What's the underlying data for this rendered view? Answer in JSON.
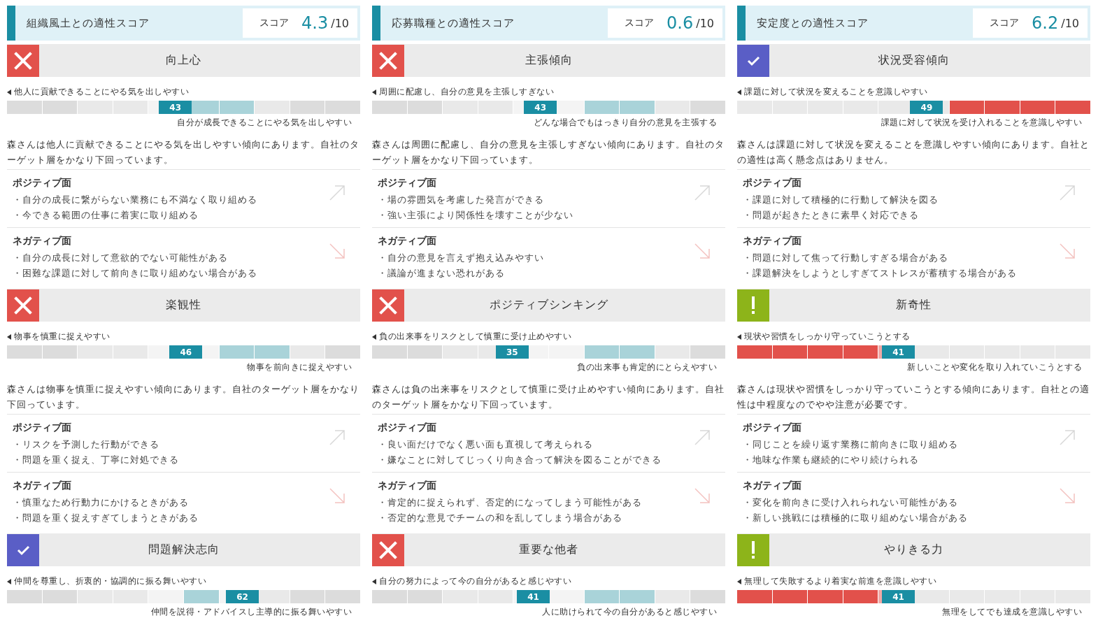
{
  "columns": [
    {
      "title": "組織風土との適性スコア",
      "score_label": "スコア",
      "score": "4.3",
      "score_total": "/10",
      "traits": [
        {
          "name": "向上心",
          "kind": "bad",
          "bar": {
            "left_label": "他人に貢献できることにやる気を出しやすい",
            "right_label": "自分が成長できることにやる気を出しやすい",
            "value": "43",
            "level": 0.43,
            "segments": [
              {
                "kind": "dark"
              },
              {
                "kind": "dark"
              },
              {
                "kind": "light"
              },
              {
                "kind": "light"
              },
              {
                "kind": "pale"
              },
              {
                "kind": "target"
              },
              {
                "kind": "target"
              },
              {
                "kind": "light"
              },
              {
                "kind": "dark"
              },
              {
                "kind": "dark"
              }
            ]
          },
          "description": "森さんは他人に貢献できることにやる気を出しやすい傾向にあります。自社のターゲット層をかなり下回っています。",
          "positive": {
            "heading": "ポジティブ面",
            "items": [
              "・自分の成長に繋がらない業務にも不満なく取り組める",
              "・今できる範囲の仕事に着実に取り組める"
            ]
          },
          "negative": {
            "heading": "ネガティブ面",
            "items": [
              "・自分の成長に対して意欲的でない可能性がある",
              "・困難な課題に対して前向きに取り組めない場合がある"
            ]
          }
        },
        {
          "name": "楽観性",
          "kind": "bad",
          "bar": {
            "left_label": "物事を慎重に捉えやすい",
            "right_label": "物事を前向きに捉えやすい",
            "value": "46",
            "level": 0.46,
            "segments": [
              {
                "kind": "dark"
              },
              {
                "kind": "dark"
              },
              {
                "kind": "light"
              },
              {
                "kind": "light"
              },
              {
                "kind": "pale"
              },
              {
                "kind": "pale"
              },
              {
                "kind": "target"
              },
              {
                "kind": "target"
              },
              {
                "kind": "light"
              },
              {
                "kind": "dark"
              }
            ]
          },
          "description": "森さんは物事を慎重に捉えやすい傾向にあります。自社のターゲット層をかなり下回っています。",
          "positive": {
            "heading": "ポジティブ面",
            "items": [
              "・リスクを予測した行動ができる",
              "・問題を重く捉え、丁寧に対処できる"
            ]
          },
          "negative": {
            "heading": "ネガティブ面",
            "items": [
              "・慎重なため行動力にかけるときがある",
              "・問題を重く捉えすぎてしまうときがある"
            ]
          }
        },
        {
          "name": "問題解決志向",
          "kind": "good",
          "bar": {
            "left_label": "仲間を尊重し、折衷的・協調的に振る舞いやすい",
            "right_label": "仲間を説得・アドバイスし主導的に振る舞いやすい",
            "value": "62",
            "level": 0.62,
            "segments": [
              {
                "kind": "dark"
              },
              {
                "kind": "dark"
              },
              {
                "kind": "light"
              },
              {
                "kind": "light"
              },
              {
                "kind": "pale"
              },
              {
                "kind": "target"
              },
              {
                "kind": "pale"
              },
              {
                "kind": "light"
              },
              {
                "kind": "dark"
              },
              {
                "kind": "dark"
              }
            ]
          }
        }
      ]
    },
    {
      "title": "応募職種との適性スコア",
      "score_label": "スコア",
      "score": "0.6",
      "score_total": "/10",
      "traits": [
        {
          "name": "主張傾向",
          "kind": "bad",
          "bar": {
            "left_label": "周囲に配慮し、自分の意見を主張しすぎない",
            "right_label": "どんな場合でもはっきり自分の意見を主張する",
            "value": "43",
            "level": 0.43,
            "segments": [
              {
                "kind": "dark"
              },
              {
                "kind": "dark"
              },
              {
                "kind": "light"
              },
              {
                "kind": "light"
              },
              {
                "kind": "pale"
              },
              {
                "kind": "pale"
              },
              {
                "kind": "target"
              },
              {
                "kind": "target"
              },
              {
                "kind": "light"
              },
              {
                "kind": "dark"
              }
            ]
          },
          "description": "森さんは周囲に配慮し、自分の意見を主張しすぎない傾向にあります。自社のターゲット層をかなり下回っています。",
          "positive": {
            "heading": "ポジティブ面",
            "items": [
              "・場の雰囲気を考慮した発言ができる",
              "・強い主張により関係性を壊すことが少ない"
            ]
          },
          "negative": {
            "heading": "ネガティブ面",
            "items": [
              "・自分の意見を言えず抱え込みやすい",
              "・議論が進まない恐れがある"
            ]
          }
        },
        {
          "name": "ポジティブシンキング",
          "kind": "bad",
          "bar": {
            "left_label": "負の出来事をリスクとして慎重に受け止めやすい",
            "right_label": "負の出来事も肯定的にとらえやすい",
            "value": "35",
            "level": 0.35,
            "segments": [
              {
                "kind": "dark"
              },
              {
                "kind": "dark"
              },
              {
                "kind": "light"
              },
              {
                "kind": "light"
              },
              {
                "kind": "pale"
              },
              {
                "kind": "pale"
              },
              {
                "kind": "target"
              },
              {
                "kind": "target"
              },
              {
                "kind": "light"
              },
              {
                "kind": "dark"
              }
            ]
          },
          "description": "森さんは負の出来事をリスクとして慎重に受け止めやすい傾向にあります。自社のターゲット層をかなり下回っています。",
          "positive": {
            "heading": "ポジティブ面",
            "items": [
              "・良い面だけでなく悪い面も直視して考えられる",
              "・嫌なことに対してじっくり向き合って解決を図ることができる"
            ]
          },
          "negative": {
            "heading": "ネガティブ面",
            "items": [
              "・肯定的に捉えられず、否定的になってしまう可能性がある",
              "・否定的な意見でチームの和を乱してしまう場合がある"
            ]
          }
        },
        {
          "name": "重要な他者",
          "kind": "bad",
          "bar": {
            "left_label": "自分の努力によって今の自分があると感じやすい",
            "right_label": "人に助けられて今の自分があると感じやすい",
            "value": "41",
            "level": 0.41,
            "segments": [
              {
                "kind": "dark"
              },
              {
                "kind": "dark"
              },
              {
                "kind": "light"
              },
              {
                "kind": "light"
              },
              {
                "kind": "pale"
              },
              {
                "kind": "pale"
              },
              {
                "kind": "target"
              },
              {
                "kind": "target"
              },
              {
                "kind": "light"
              },
              {
                "kind": "dark"
              }
            ]
          }
        }
      ]
    },
    {
      "title": "安定度との適性スコア",
      "score_label": "スコア",
      "score": "6.2",
      "score_total": "/10",
      "traits": [
        {
          "name": "状況受容傾向",
          "kind": "good",
          "bar": {
            "left_label": "課題に対して状況を変えることを意識しやすい",
            "right_label": "課題に対して状況を受け入れることを意識しやすい",
            "value": "49",
            "level": 0.49,
            "segments": [
              {
                "kind": "light"
              },
              {
                "kind": "light"
              },
              {
                "kind": "light"
              },
              {
                "kind": "light"
              },
              {
                "kind": "light"
              },
              {
                "kind": "light"
              },
              {
                "kind": "risk"
              },
              {
                "kind": "risk"
              },
              {
                "kind": "risk"
              },
              {
                "kind": "risk"
              }
            ]
          },
          "description": "森さんは課題に対して状況を変えることを意識しやすい傾向にあります。自社との適性は高く懸念点はありません。",
          "positive": {
            "heading": "ポジティブ面",
            "items": [
              "・課題に対して積極的に行動して解決を図る",
              "・問題が起きたときに素早く対応できる"
            ]
          },
          "negative": {
            "heading": "ネガティブ面",
            "items": [
              "・問題に対して焦って行動しすぎる場合がある",
              "・課題解決をしようとしすぎてストレスが蓄積する場合がある"
            ]
          }
        },
        {
          "name": "新奇性",
          "kind": "warn",
          "bar": {
            "left_label": "現状や習慣をしっかり守っていこうとする",
            "right_label": "新しいことや変化を取り入れていこうとする",
            "value": "41",
            "level": 0.41,
            "segments": [
              {
                "kind": "risk"
              },
              {
                "kind": "risk"
              },
              {
                "kind": "risk"
              },
              {
                "kind": "risk"
              },
              {
                "kind": "riskpale"
              },
              {
                "kind": "light"
              },
              {
                "kind": "light"
              },
              {
                "kind": "light"
              },
              {
                "kind": "light"
              },
              {
                "kind": "light"
              }
            ]
          },
          "description": "森さんは現状や習慣をしっかり守っていこうとする傾向にあります。自社との適性は中程度なのでやや注意が必要です。",
          "positive": {
            "heading": "ポジティブ面",
            "items": [
              "・同じことを繰り返す業務に前向きに取り組める",
              "・地味な作業も継続的にやり続けられる"
            ]
          },
          "negative": {
            "heading": "ネガティブ面",
            "items": [
              "・変化を前向きに受け入れられない可能性がある",
              "・新しい挑戦には積極的に取り組めない場合がある"
            ]
          }
        },
        {
          "name": "やりきる力",
          "kind": "warn",
          "bar": {
            "left_label": "無理して失敗するより着実な前進を意識しやすい",
            "right_label": "無理をしてでも達成を意識しやすい",
            "value": "41",
            "level": 0.41,
            "segments": [
              {
                "kind": "risk"
              },
              {
                "kind": "risk"
              },
              {
                "kind": "risk"
              },
              {
                "kind": "risk"
              },
              {
                "kind": "riskpale"
              },
              {
                "kind": "light"
              },
              {
                "kind": "light"
              },
              {
                "kind": "light"
              },
              {
                "kind": "light"
              },
              {
                "kind": "light"
              }
            ]
          }
        }
      ]
    }
  ]
}
